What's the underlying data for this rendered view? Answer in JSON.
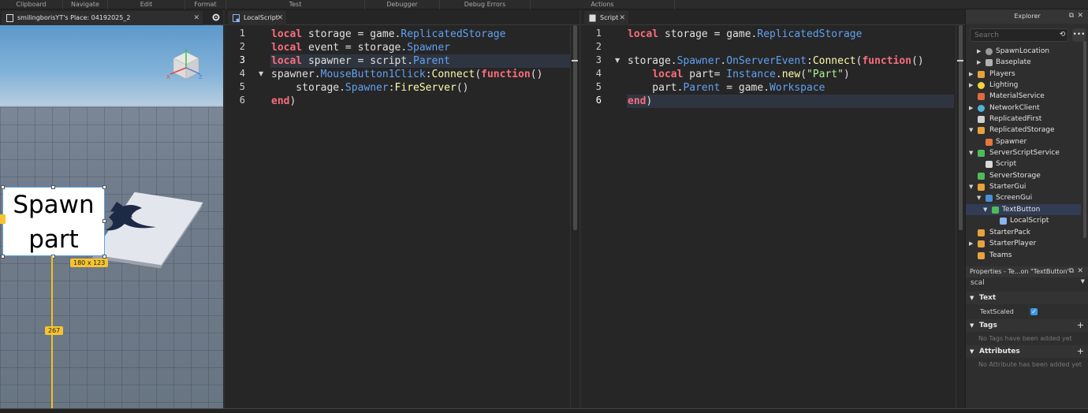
{
  "ribbon": [
    "Clipboard",
    "Navigate",
    "Edit",
    "Format",
    "Test",
    "Debugger",
    "Debug Errors",
    "Actions"
  ],
  "viewport": {
    "tab_title": "smilingborisYT's Place: 04192025_2",
    "button_text_line1": "Spawn",
    "button_text_line2": "part",
    "size_badge": "180 x 123",
    "distance_badge": "267"
  },
  "localscript": {
    "tab_title": "LocalScript",
    "line_numbers": [
      "1",
      "2",
      "3",
      "4",
      "5",
      "6"
    ]
  },
  "script": {
    "tab_title": "Script",
    "line_numbers": [
      "1",
      "2",
      "3",
      "4",
      "5",
      "6"
    ]
  },
  "explorer": {
    "title": "Explorer",
    "search_placeholder": "Search",
    "items": [
      "SpawnLocation",
      "Baseplate",
      "Players",
      "Lighting",
      "MaterialService",
      "NetworkClient",
      "ReplicatedFirst",
      "ReplicatedStorage",
      "Spawner",
      "ServerScriptService",
      "Script",
      "ServerStorage",
      "StarterGui",
      "ScreenGui",
      "TextButton",
      "LocalScript",
      "StarterPack",
      "StarterPlayer",
      "Teams"
    ]
  },
  "properties": {
    "title": "Properties - Te...on \"TextButton\"",
    "filter_value": "scal",
    "section_text": "Text",
    "prop_textscaled": "TextScaled",
    "textscaled_checked": true,
    "section_tags": "Tags",
    "tags_empty": "No Tags have been added yet",
    "section_attributes": "Attributes",
    "attributes_empty": "No Attribute has been added yet"
  },
  "colors": {
    "keyword": "#f86d7c",
    "property": "#61a1f1",
    "method": "#fdfbac",
    "string": "#adf195",
    "selection": "#323c55"
  }
}
